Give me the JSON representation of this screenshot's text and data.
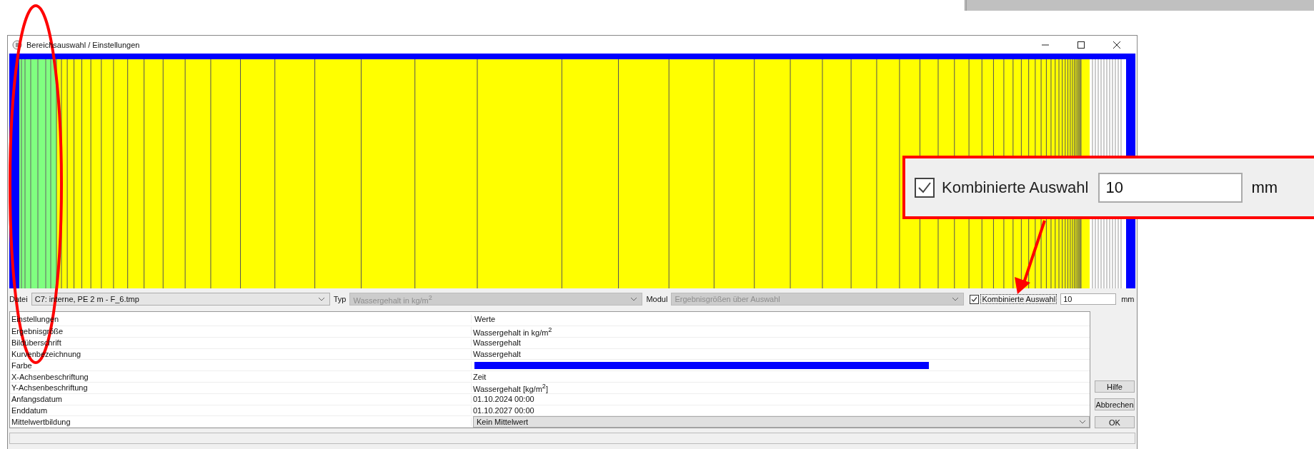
{
  "window": {
    "title": "Bereichsauswahl / Einstellungen"
  },
  "selectors": [
    {
      "label": "Datei",
      "value": "C7: interne, PE 2 m - F_6.tmp",
      "disabled": false
    },
    {
      "label": "Typ",
      "value": "Wassergehalt in kg/m$^{2}$",
      "disabled": true
    },
    {
      "label": "Modul",
      "value": "Ergebnisgrößen über Auswahl",
      "disabled": true
    }
  ],
  "combined_selection": {
    "label": "Kombinierte Auswahl",
    "checked": true,
    "value": "10",
    "unit": "mm"
  },
  "table": {
    "columns": [
      "Einstellungen",
      "Werte"
    ],
    "rows": [
      {
        "name": "Ergebnisgröße",
        "kind": "text",
        "value": "Wassergehalt in kg/m$^{2}$"
      },
      {
        "name": "Bildüberschrift",
        "kind": "text",
        "value": "Wassergehalt"
      },
      {
        "name": "Kurvenbezeichnung",
        "kind": "text",
        "value": "Wassergehalt"
      },
      {
        "name": "Farbe",
        "kind": "color",
        "color": "#0000ff"
      },
      {
        "name": "X-Achsenbeschriftung",
        "kind": "text",
        "value": "Zeit"
      },
      {
        "name": "Y-Achsenbeschriftung",
        "kind": "text",
        "value": "Wassergehalt [kg/m$^{2}$]"
      },
      {
        "name": "Anfangsdatum",
        "kind": "text",
        "value": "01.10.2024 00:00"
      },
      {
        "name": "Enddatum",
        "kind": "text",
        "value": "01.10.2027 00:00"
      },
      {
        "name": "Mittelwertbildung",
        "kind": "dropdown",
        "value": "Kein Mittelwert"
      }
    ]
  },
  "buttons": [
    "Hilfe",
    "Abbrechen",
    "OK"
  ],
  "callout": {
    "label": "Kombinierte Auswahl",
    "checked": true,
    "value": "10",
    "unit": "mm"
  }
}
